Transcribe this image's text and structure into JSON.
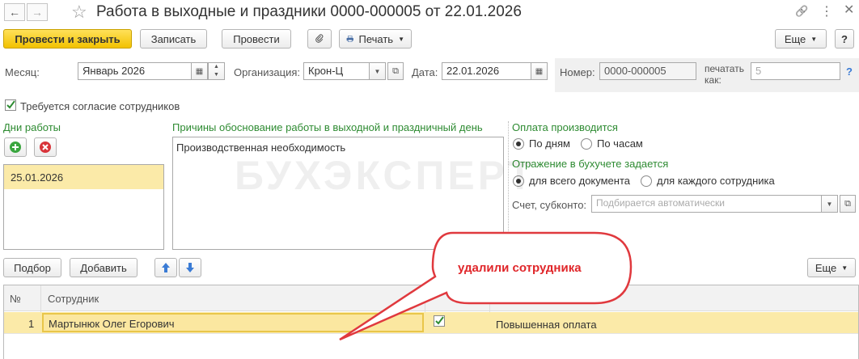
{
  "window": {
    "title": "Работа в выходные и праздники 0000-000005 от 22.01.2026",
    "back": "←",
    "forward": "→",
    "star": "☆",
    "link": "🔗",
    "menu": "⋮",
    "restore": "☐",
    "close": "✕"
  },
  "toolbar": {
    "post_close": "Провести и закрыть",
    "write": "Записать",
    "post": "Провести",
    "print": "Печать",
    "more": "Еще",
    "help": "?"
  },
  "fields": {
    "month_label": "Месяц:",
    "month_value": "Январь 2026",
    "org_label": "Организация:",
    "org_value": "Крон-Ц",
    "date_label": "Дата:",
    "date_value": "22.01.2026",
    "number_label": "Номер:",
    "number_value": "0000-000005",
    "print_as_label": "печатать как:",
    "print_as_value": "5",
    "help": "?"
  },
  "consent": {
    "label": "Требуется согласие сотрудников",
    "checked": true
  },
  "work_days": {
    "title": "Дни работы",
    "items": [
      "25.01.2026"
    ]
  },
  "reasons": {
    "title": "Причины обоснование работы в выходной и праздничный день",
    "text": "Производственная необходимость"
  },
  "payment": {
    "title": "Оплата производится",
    "options": [
      "По дням",
      "По часам"
    ],
    "selected": 0
  },
  "accounting": {
    "title": "Отражение в бухучете задается",
    "options": [
      "для всего документа",
      "для каждого сотрудника"
    ],
    "selected": 0,
    "account_label": "Счет, субконто:",
    "account_placeholder": "Подбирается автоматически"
  },
  "table_toolbar": {
    "pick": "Подбор",
    "add": "Добавить",
    "more": "Еще"
  },
  "table": {
    "columns": [
      "№",
      "Сотрудник"
    ],
    "rows": [
      {
        "num": "1",
        "employee": "Мартынюк Олег Егорович",
        "checked": true,
        "payment": "Повышенная оплата"
      }
    ]
  },
  "callout": {
    "text": "удалили сотрудника"
  },
  "watermark": {
    "text": "БУХЭКСПЕРТ"
  },
  "colors": {
    "accent_yellow": "#f2c200",
    "green_title": "#2e8b32",
    "callout_border": "#e0393e",
    "callout_text": "#e0262a",
    "selected_row": "#fbeaa8"
  }
}
